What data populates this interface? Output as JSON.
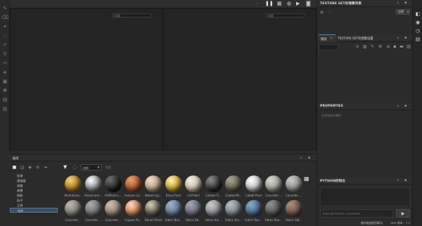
{
  "viewport": {
    "left_search_placeholder": "检索",
    "right_search_placeholder": "检索"
  },
  "texture_set_list": {
    "title": "TEXTURE SET纹理集列表",
    "settings_label": "设置",
    "settings_arrow": "▾"
  },
  "texture_set_settings": {
    "tab_layers": "图层",
    "tab_settings": "TEXTURE SET纹理集设置"
  },
  "properties": {
    "title": "PROPERTIES",
    "empty_text": "未发现选中属性"
  },
  "python": {
    "title": "PYTHON控制台",
    "input_placeholder": "Execute Python command..."
  },
  "shelf": {
    "title": "展架",
    "search_tag": "材质",
    "search_placeholder": "搜索",
    "categories": [
      "纹理",
      "通道器",
      "滤器",
      "遮罩",
      "智能",
      "粒子",
      "工具",
      "材质"
    ],
    "selected_category": "材质",
    "materials_row1": [
      {
        "name": "Aluminium...",
        "color": "gold"
      },
      {
        "name": "Aluminium...",
        "color": "chrome"
      },
      {
        "name": "Artificial L...",
        "color": "black"
      },
      {
        "name": "Autumn Le...",
        "color": "leaf"
      },
      {
        "name": "Baked Lig...",
        "color": "beige"
      },
      {
        "name": "Brass Pure",
        "color": "brass"
      },
      {
        "name": "Calf Skin",
        "color": "cream"
      },
      {
        "name": "Carbon Fi...",
        "color": "darkgray"
      },
      {
        "name": "Coated M...",
        "color": "olive"
      },
      {
        "name": "Cobalt Pure",
        "color": "silver"
      },
      {
        "name": "Concrete ...",
        "color": "concrete1"
      },
      {
        "name": "Concrete ...",
        "color": "concrete2"
      }
    ],
    "materials_row2": [
      {
        "name": "Concrete ...",
        "color": "concrete3"
      },
      {
        "name": "Concrete ...",
        "color": "concrete4"
      },
      {
        "name": "Concrete ...",
        "color": "concrete5"
      },
      {
        "name": "Copper Pu...",
        "color": "copper"
      },
      {
        "name": "Denim Rivet",
        "color": "rivet"
      },
      {
        "name": "Fabric Bas...",
        "color": "fabric1"
      },
      {
        "name": "Fabric Ba...",
        "color": "fabric2"
      },
      {
        "name": "Fabric Kni...",
        "color": "fabric3"
      },
      {
        "name": "Fabric Kni...",
        "color": "fabric4"
      },
      {
        "name": "Fabric Rou...",
        "color": "fabric5"
      },
      {
        "name": "Fabric Rou...",
        "color": "fabric6"
      },
      {
        "name": "Fabric Sof...",
        "color": "fabric7"
      }
    ]
  },
  "status": {
    "text": "缓存磁盘使用情况:",
    "percent": "26%",
    "version_label": "版本:",
    "version_value": "7.2"
  }
}
